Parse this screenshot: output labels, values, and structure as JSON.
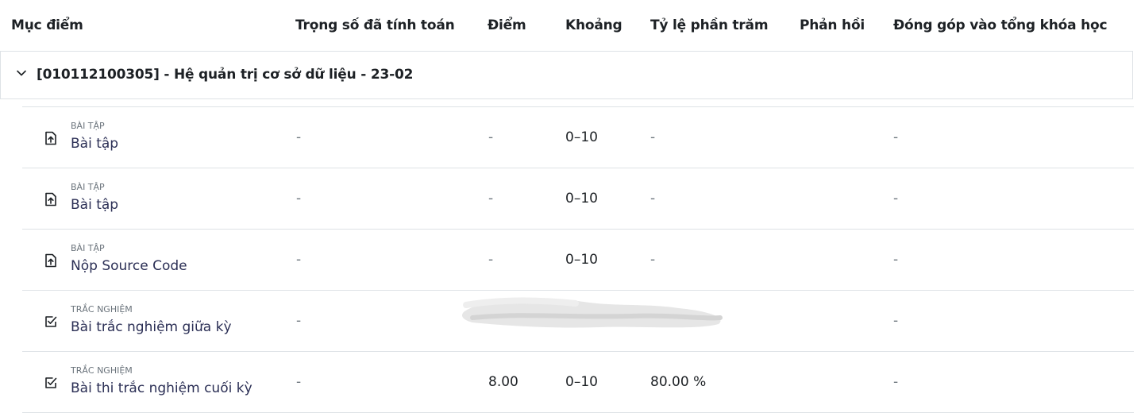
{
  "table": {
    "headers": {
      "item": "Mục điểm",
      "weight": "Trọng số đã tính toán",
      "grade": "Điểm",
      "range": "Khoảng",
      "percentage": "Tỷ lệ phần trăm",
      "feedback": "Phản hồi",
      "contribution": "Đóng góp vào tổng khóa học"
    },
    "course": {
      "title": "[010112100305] - Hệ quản trị cơ sở dữ liệu - 23-02",
      "expanded": true
    },
    "rows": [
      {
        "type": "BÀI TẬP",
        "icon": "assignment-upload-icon",
        "name": "Bài tập",
        "weight": "-",
        "grade": "-",
        "range": "0–10",
        "percentage": "-",
        "feedback": "",
        "contribution": "-"
      },
      {
        "type": "BÀI TẬP",
        "icon": "assignment-upload-icon",
        "name": "Bài tập",
        "weight": "-",
        "grade": "-",
        "range": "0–10",
        "percentage": "-",
        "feedback": "",
        "contribution": "-"
      },
      {
        "type": "BÀI TẬP",
        "icon": "assignment-upload-icon",
        "name": "Nộp Source Code",
        "weight": "-",
        "grade": "-",
        "range": "0–10",
        "percentage": "-",
        "feedback": "",
        "contribution": "-"
      },
      {
        "type": "TRẮC NGHIỆM",
        "icon": "quiz-checkbox-icon",
        "name": "Bài trắc nghiệm giữa kỳ",
        "weight": "-",
        "grade": "",
        "range": "",
        "percentage": "",
        "feedback": "",
        "contribution": "-",
        "redacted": true
      },
      {
        "type": "TRẮC NGHIỆM",
        "icon": "quiz-checkbox-icon",
        "name": "Bài thi trắc nghiệm cuối kỳ",
        "weight": "-",
        "grade": "8.00",
        "range": "0–10",
        "percentage": "80.00 %",
        "feedback": "",
        "contribution": "-"
      }
    ]
  },
  "colors": {
    "link": "#2b2f55",
    "muted": "#6a737b",
    "border": "#dee2e6",
    "redaction": "#e6e6e6"
  }
}
